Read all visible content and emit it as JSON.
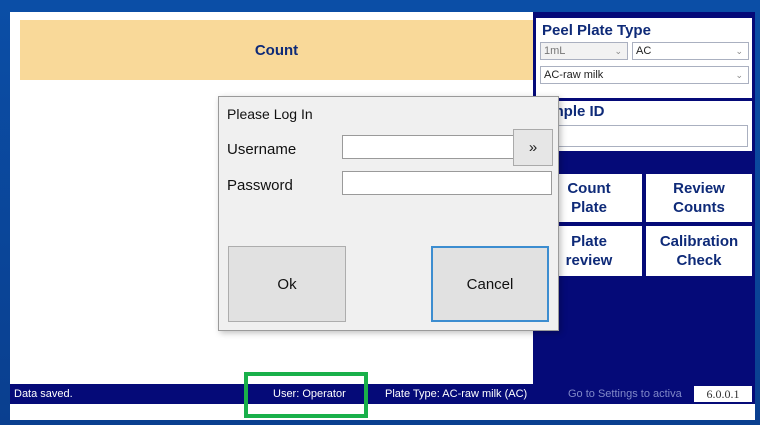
{
  "count_header": "Count",
  "peel_plate": {
    "title": "Peel Plate Type",
    "volume": "1mL",
    "type": "AC",
    "sample_type": "AC-raw milk"
  },
  "sample": {
    "title": "Sample ID",
    "visible_title": "ample ID",
    "value": ""
  },
  "tiles": {
    "count_plate": "Count Plate",
    "review_counts": "Review Counts",
    "plate_preview": "Plate Preview",
    "plate_preview_visible": "Plate\nreview",
    "calibration_check": "Calibration Check"
  },
  "status": {
    "message": "Data saved.",
    "user": "User: Operator",
    "plate_type": "Plate Type: AC-raw milk (AC)",
    "watermark": "Go to Settings to activa",
    "version": "6.0.0.1"
  },
  "login": {
    "title": "Please Log In",
    "username_label": "Username",
    "password_label": "Password",
    "username_value": "",
    "password_value": "",
    "go_label": "»",
    "ok_label": "Ok",
    "cancel_label": "Cancel"
  },
  "colors": {
    "navy": "#050a78",
    "header_orange": "#f9d999",
    "highlight_green": "#19b04a",
    "focus_blue": "#3c8dd0"
  }
}
